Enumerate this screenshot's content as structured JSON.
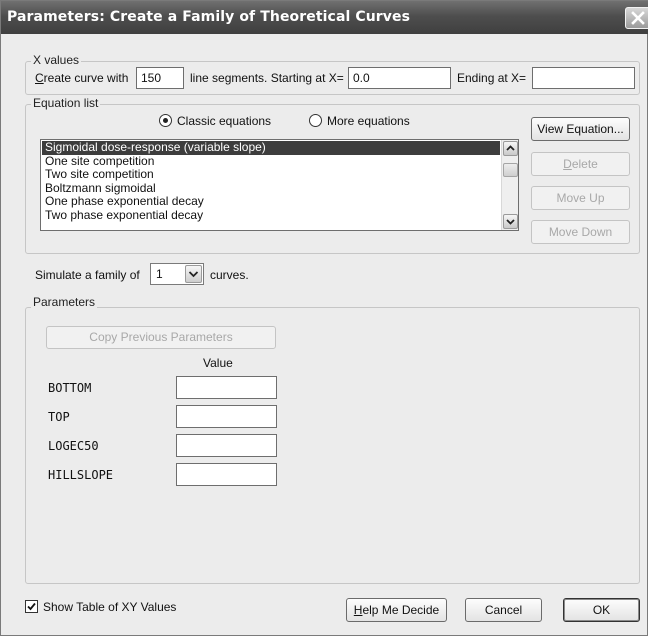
{
  "window": {
    "title": "Parameters: Create a Family of Theoretical Curves"
  },
  "x_values": {
    "group_label": "X values",
    "create_prefix_underlined": "C",
    "create_prefix_rest": "reate curve with",
    "segments_value": "150",
    "segments_suffix": "line segments. Starting at X=",
    "start_value": "0.0",
    "ending_label": "Ending at X=",
    "ending_value": ""
  },
  "equation_list": {
    "group_label": "Equation list",
    "classic_label": "Classic equations",
    "more_label": "More equations",
    "selected_radio": "classic",
    "items": [
      "Sigmoidal dose-response (variable slope)",
      "One site competition",
      "Two site competition",
      "Boltzmann sigmoidal",
      "One phase exponential decay",
      "Two phase exponential decay"
    ],
    "selected_index": 0,
    "view_button": "View Equation...",
    "delete_button_underlined": "D",
    "delete_button_rest": "elete",
    "move_up_button": "Move Up",
    "move_down_button": "Move Down"
  },
  "simulate": {
    "prefix": "Simulate a family of",
    "count": "1",
    "suffix": "curves."
  },
  "parameters": {
    "group_label": "Parameters",
    "copy_button": "Copy Previous Parameters",
    "value_header": "Value",
    "rows": [
      {
        "name": "BOTTOM",
        "value": ""
      },
      {
        "name": "TOP",
        "value": ""
      },
      {
        "name": "LOGEC50",
        "value": ""
      },
      {
        "name": "HILLSLOPE",
        "value": ""
      }
    ]
  },
  "footer": {
    "show_table_label": "Show Table of XY Values",
    "show_table_checked": true,
    "help_button_underlined": "H",
    "help_button_rest": "elp Me Decide",
    "cancel_button": "Cancel",
    "ok_button": "OK"
  }
}
